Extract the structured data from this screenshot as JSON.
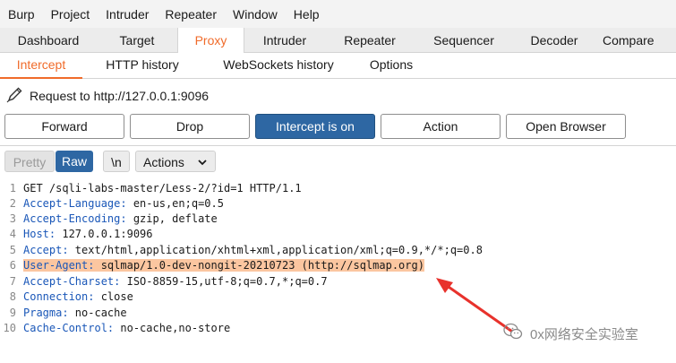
{
  "menu": [
    "Burp",
    "Project",
    "Intruder",
    "Repeater",
    "Window",
    "Help"
  ],
  "tool_tabs": [
    "Dashboard",
    "Target",
    "Proxy",
    "Intruder",
    "Repeater",
    "Sequencer",
    "Decoder",
    "Compare"
  ],
  "proxy_tabs": [
    "Intercept",
    "HTTP history",
    "WebSockets history",
    "Options"
  ],
  "request_label": "Request to http://127.0.0.1:9096",
  "buttons": {
    "forward": "Forward",
    "drop": "Drop",
    "intercept": "Intercept is on",
    "action": "Action",
    "open_browser": "Open Browser"
  },
  "editor_toolbar": {
    "pretty": "Pretty",
    "raw": "Raw",
    "newline": "\\n",
    "actions": "Actions"
  },
  "request_lines": [
    {
      "num": "1",
      "key": "",
      "value": "GET /sqli-labs-master/Less-2/?id=1 HTTP/1.1"
    },
    {
      "num": "2",
      "key": "Accept-Language:",
      "value": " en-us,en;q=0.5"
    },
    {
      "num": "3",
      "key": "Accept-Encoding:",
      "value": " gzip, deflate"
    },
    {
      "num": "4",
      "key": "Host:",
      "value": " 127.0.0.1:9096"
    },
    {
      "num": "5",
      "key": "Accept:",
      "value": " text/html,application/xhtml+xml,application/xml;q=0.9,*/*;q=0.8"
    },
    {
      "num": "6",
      "key": "User-Agent:",
      "value": " sqlmap/1.0-dev-nongit-20210723 (http://sqlmap.org)"
    },
    {
      "num": "7",
      "key": "Accept-Charset:",
      "value": " ISO-8859-15,utf-8;q=0.7,*;q=0.7"
    },
    {
      "num": "8",
      "key": "Connection:",
      "value": " close"
    },
    {
      "num": "9",
      "key": "Pragma:",
      "value": " no-cache"
    },
    {
      "num": "10",
      "key": "Cache-Control:",
      "value": " no-cache,no-store"
    }
  ],
  "highlighted_line": "6",
  "watermark": "0x网络安全实验室",
  "colors": {
    "accent": "#f06b2a",
    "primary_button": "#2e67a3",
    "header_key": "#1a57b8",
    "highlight": "#fbc6a0",
    "arrow": "#e8322c"
  }
}
